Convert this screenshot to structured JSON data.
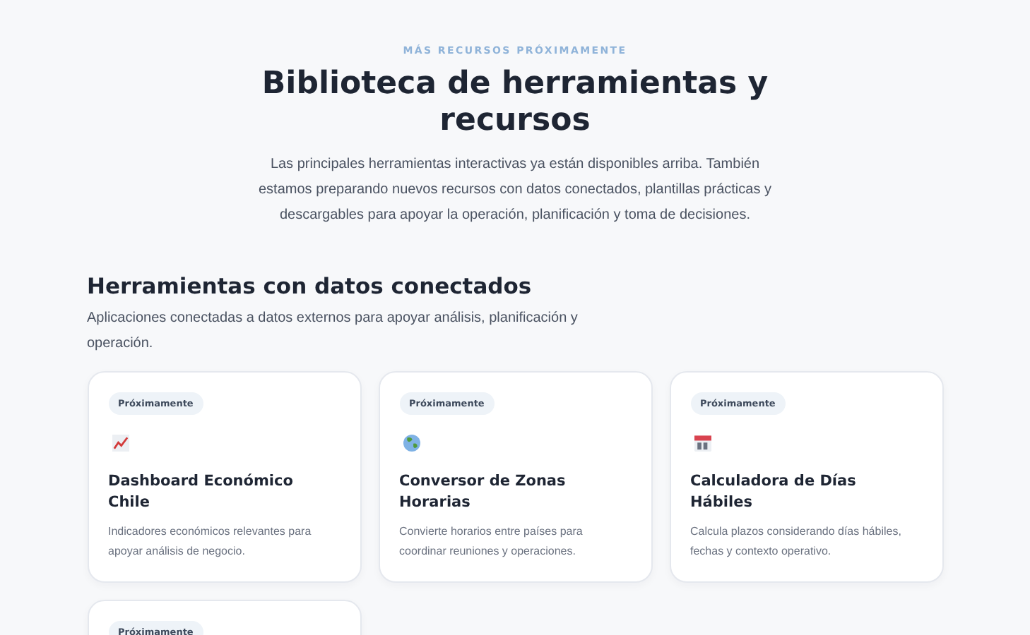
{
  "eyebrow": "MÁS RECURSOS PRÓXIMAMENTE",
  "title": "Biblioteca de herramientas y recursos",
  "intro": "Las principales herramientas interactivas ya están disponibles arriba. También estamos preparando nuevos recursos con datos conectados, plantillas prácticas y descargables para apoyar la operación, planificación y toma de decisiones.",
  "section": {
    "title": "Herramientas con datos conectados",
    "description": "Aplicaciones conectadas a datos externos para apoyar análisis, planificación y operación.",
    "cards": [
      {
        "badge": "Próximamente",
        "title": "Dashboard Económico Chile",
        "description": "Indicadores económicos relevantes para apoyar análisis de negocio."
      },
      {
        "badge": "Próximamente",
        "title": "Conversor de Zonas Horarias",
        "description": "Convierte horarios entre países para coordinar reuniones y operaciones."
      },
      {
        "badge": "Próximamente",
        "title": "Calculadora de Días Hábiles",
        "description": "Calcula plazos considerando días hábiles, fechas y contexto operativo."
      },
      {
        "badge": "Próximamente"
      }
    ]
  }
}
